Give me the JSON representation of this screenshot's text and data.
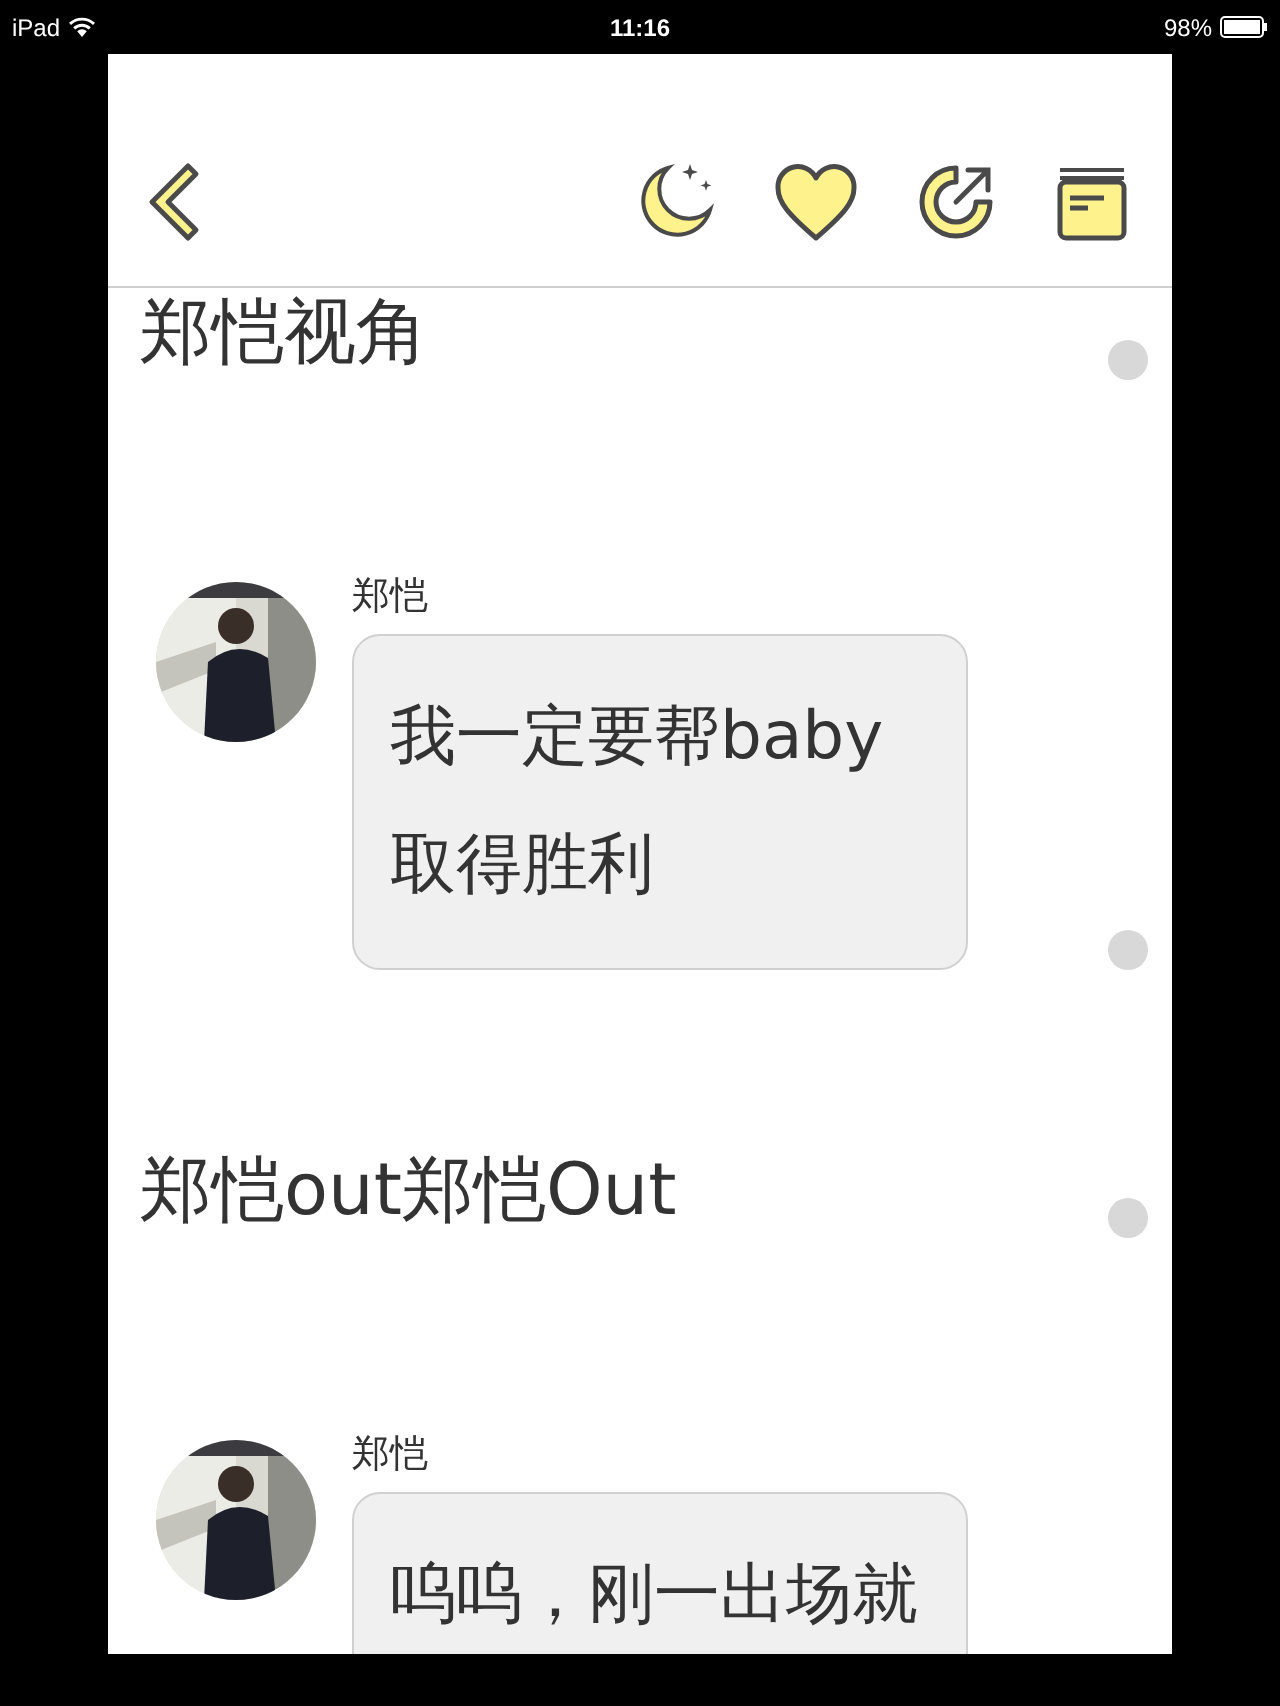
{
  "status_bar": {
    "device": "iPad",
    "time": "11:16",
    "battery": "98%"
  },
  "items": [
    {
      "kind": "narration",
      "text": "郑恺视角"
    },
    {
      "kind": "message",
      "sender": "郑恺",
      "text": "我一定要帮baby取得胜利"
    },
    {
      "kind": "narration",
      "text": "郑恺out郑恺Out"
    },
    {
      "kind": "message",
      "sender": "郑恺",
      "text": "呜呜，刚一出场就"
    }
  ]
}
